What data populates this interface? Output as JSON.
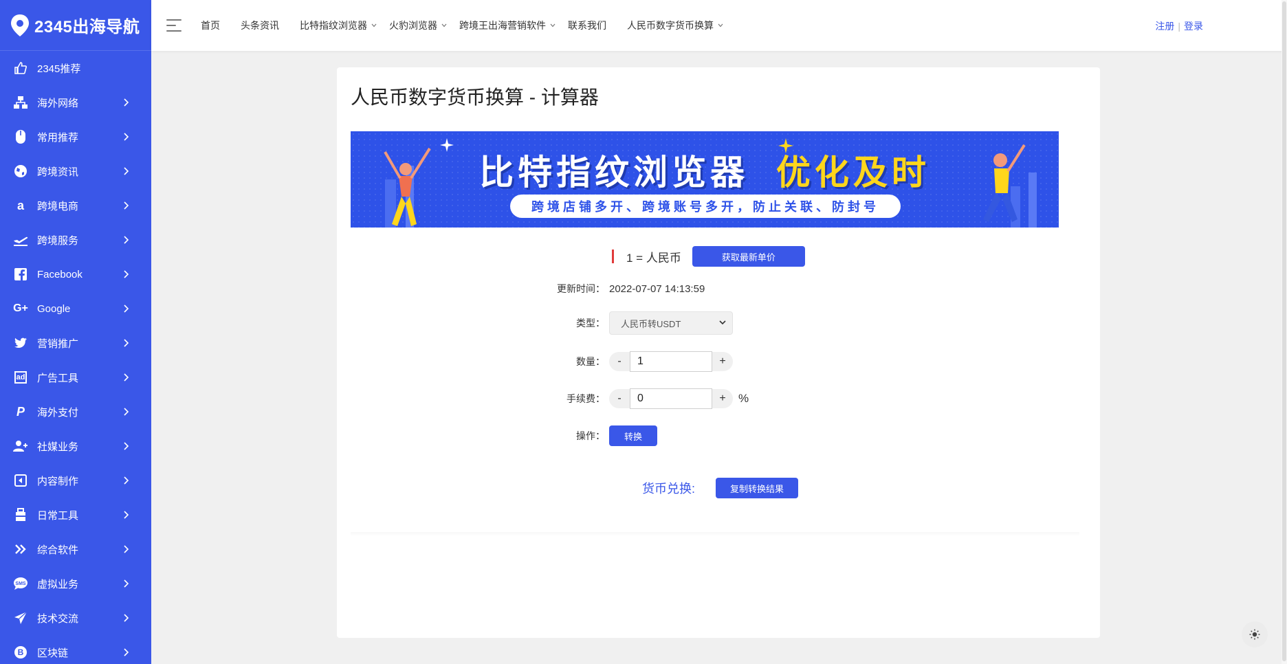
{
  "brand": {
    "name": "2345出海导航"
  },
  "sidebar": {
    "items": [
      {
        "label": "2345推荐",
        "icon": "thumbs-up-icon",
        "has_children": false
      },
      {
        "label": "海外网络",
        "icon": "network-icon",
        "has_children": true
      },
      {
        "label": "常用推荐",
        "icon": "mouse-icon",
        "has_children": true
      },
      {
        "label": "跨境资讯",
        "icon": "globe-icon",
        "has_children": true
      },
      {
        "label": "跨境电商",
        "icon": "amazon-icon",
        "has_children": true
      },
      {
        "label": "跨境服务",
        "icon": "plane-icon",
        "has_children": true
      },
      {
        "label": "Facebook",
        "icon": "facebook-icon",
        "has_children": true
      },
      {
        "label": "Google",
        "icon": "google-plus-icon",
        "has_children": true
      },
      {
        "label": "营销推广",
        "icon": "twitter-icon",
        "has_children": true
      },
      {
        "label": "广告工具",
        "icon": "ad-icon",
        "has_children": true
      },
      {
        "label": "海外支付",
        "icon": "paypal-icon",
        "has_children": true
      },
      {
        "label": "社媒业务",
        "icon": "user-plus-icon",
        "has_children": true
      },
      {
        "label": "内容制作",
        "icon": "media-icon",
        "has_children": true
      },
      {
        "label": "日常工具",
        "icon": "toolbox-icon",
        "has_children": true
      },
      {
        "label": "综合软件",
        "icon": "double-chevron-icon",
        "has_children": true
      },
      {
        "label": "虚拟业务",
        "icon": "sms-icon",
        "has_children": true
      },
      {
        "label": "技术交流",
        "icon": "paper-plane-icon",
        "has_children": true
      },
      {
        "label": "区块链",
        "icon": "bitcoin-icon",
        "has_children": true
      }
    ]
  },
  "topbar": {
    "links": [
      {
        "label": "首页",
        "dropdown": false
      },
      {
        "label": "头条资讯",
        "dropdown": false
      },
      {
        "label": "比特指纹浏览器",
        "dropdown": true
      },
      {
        "label": "火豹浏览器",
        "dropdown": true
      },
      {
        "label": "跨境王出海营销软件",
        "dropdown": true
      },
      {
        "label": "联系我们",
        "dropdown": false
      },
      {
        "label": "人民币数字货币换算",
        "dropdown": true
      }
    ],
    "register": "注册",
    "login": "登录"
  },
  "page": {
    "title": "人民币数字货币换算 - 计算器",
    "banner": {
      "headline_white": "比特指纹浏览器",
      "headline_yellow": "优化及时",
      "tagline": "跨境店铺多开、跨境账号多开，防止关联、防封号"
    },
    "calculator": {
      "rate_text": "1 = 人民币",
      "get_price_button": "获取最新单价",
      "update_time_label": "更新时间",
      "update_time_value": "2022-07-07 14:13:59",
      "type_label": "类型",
      "type_value": "人民币转USDT",
      "quantity_label": "数量",
      "quantity_value": "1",
      "fee_label": "手续费",
      "fee_value": "0",
      "percent_sign": "%",
      "action_label": "操作",
      "convert_button": "转换",
      "exchange_label": "货币兑换:",
      "copy_button": "复制转换结果",
      "minus": "-",
      "plus": "+"
    }
  },
  "colors": {
    "accent": "#3a57e8",
    "highlight": "#ffd61c",
    "marker": "#e03a3a"
  }
}
